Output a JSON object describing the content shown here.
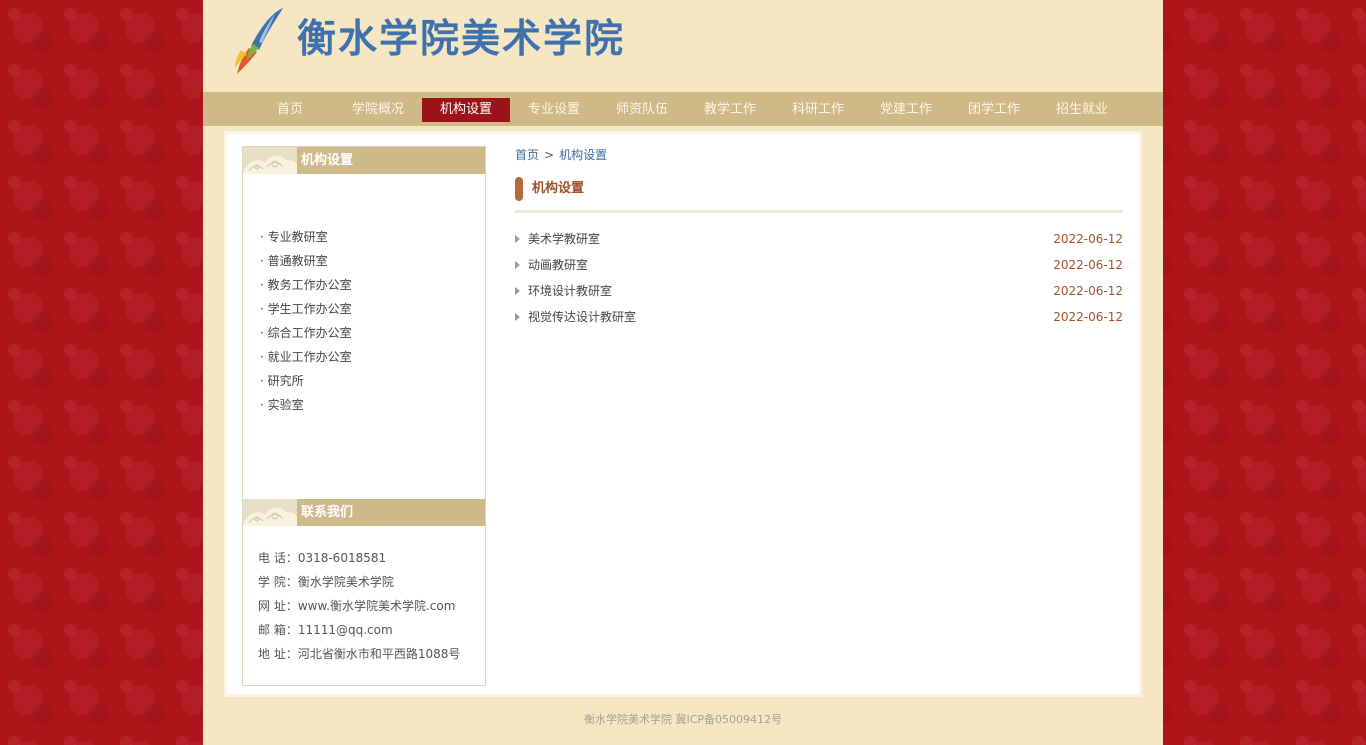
{
  "header": {
    "title": "衡水学院美术学院"
  },
  "nav": {
    "items": [
      {
        "label": "首页"
      },
      {
        "label": "学院概况"
      },
      {
        "label": "机构设置"
      },
      {
        "label": "专业设置"
      },
      {
        "label": "师资队伍"
      },
      {
        "label": "教学工作"
      },
      {
        "label": "科研工作"
      },
      {
        "label": "党建工作"
      },
      {
        "label": "团学工作"
      },
      {
        "label": "招生就业"
      }
    ],
    "active_index": 2
  },
  "sidebar": {
    "title": "机构设置",
    "items": [
      {
        "label": "· 专业教研室"
      },
      {
        "label": "· 普通教研室"
      },
      {
        "label": "· 教务工作办公室"
      },
      {
        "label": "· 学生工作办公室"
      },
      {
        "label": "· 综合工作办公室"
      },
      {
        "label": "· 就业工作办公室"
      },
      {
        "label": "· 研究所"
      },
      {
        "label": "· 实验室"
      }
    ]
  },
  "contact": {
    "title": "联系我们",
    "lines": [
      {
        "text": "电 话：0318-6018581"
      },
      {
        "text": "学 院：衡水学院美术学院"
      },
      {
        "text": "网 址：www.衡水学院美术学院.com"
      },
      {
        "text": "邮 箱：11111@qq.com"
      },
      {
        "text": "地 址：河北省衡水市和平西路1088号"
      }
    ]
  },
  "breadcrumb": {
    "home": "首页",
    "separator": ">",
    "current": "机构设置"
  },
  "main": {
    "title": "机构设置",
    "articles": [
      {
        "title": "美术学教研室",
        "date": "2022-06-12"
      },
      {
        "title": "动画教研室",
        "date": "2022-06-12"
      },
      {
        "title": "环境设计教研室",
        "date": "2022-06-12"
      },
      {
        "title": "视觉传达设计教研室",
        "date": "2022-06-12"
      }
    ]
  },
  "footer": {
    "text": "衡水学院美术学院 冀ICP备05009412号"
  },
  "colors": {
    "background": "#b0141b",
    "page": "#f5e6c4",
    "nav": "#ceb987",
    "nav_active": "#9c1317",
    "title_blue": "#3f72ad",
    "date": "#a0522d"
  }
}
